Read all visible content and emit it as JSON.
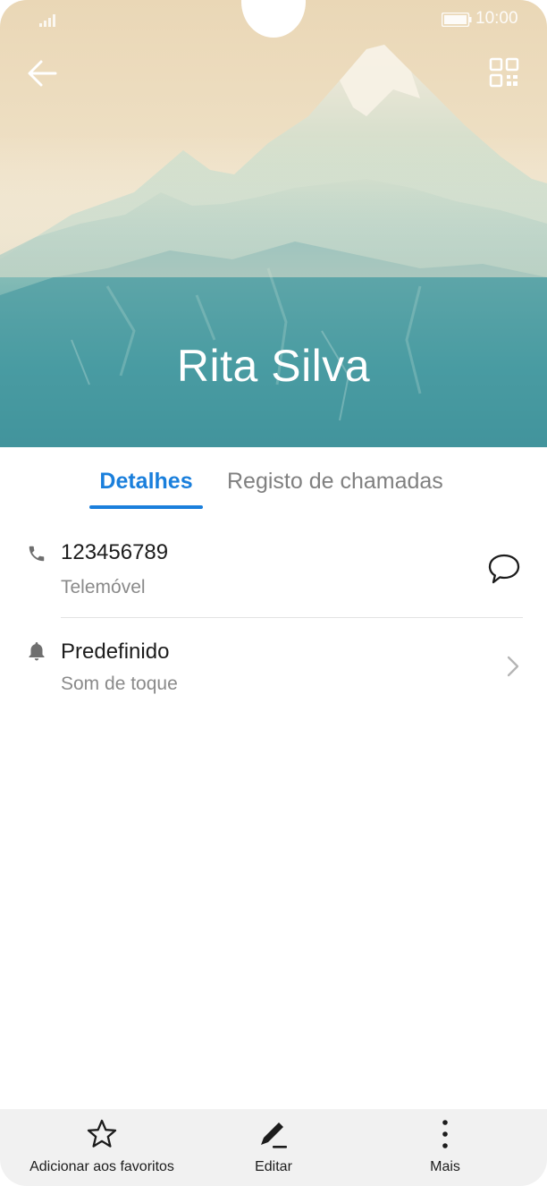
{
  "status_bar": {
    "time": "10:00"
  },
  "header": {
    "contact_name": "Rita Silva",
    "back_icon": "back-arrow-icon",
    "qr_icon": "qr-code-icon"
  },
  "tabs": [
    {
      "label": "Detalhes",
      "active": true
    },
    {
      "label": "Registo de chamadas",
      "active": false
    }
  ],
  "details": {
    "phone": {
      "number": "123456789",
      "type": "Telemóvel",
      "icon": "phone-icon",
      "action_icon": "message-icon"
    },
    "ringtone": {
      "value": "Predefinido",
      "label": "Som de toque",
      "icon": "bell-icon",
      "action_icon": "chevron-right-icon"
    }
  },
  "bottom_bar": {
    "favorites_label": "Adicionar aos favoritos",
    "edit_label": "Editar",
    "more_label": "Mais"
  },
  "colors": {
    "accent": "#1a7fdc",
    "sky": "#ecdcc0",
    "mountain": "#3f9aa2"
  }
}
